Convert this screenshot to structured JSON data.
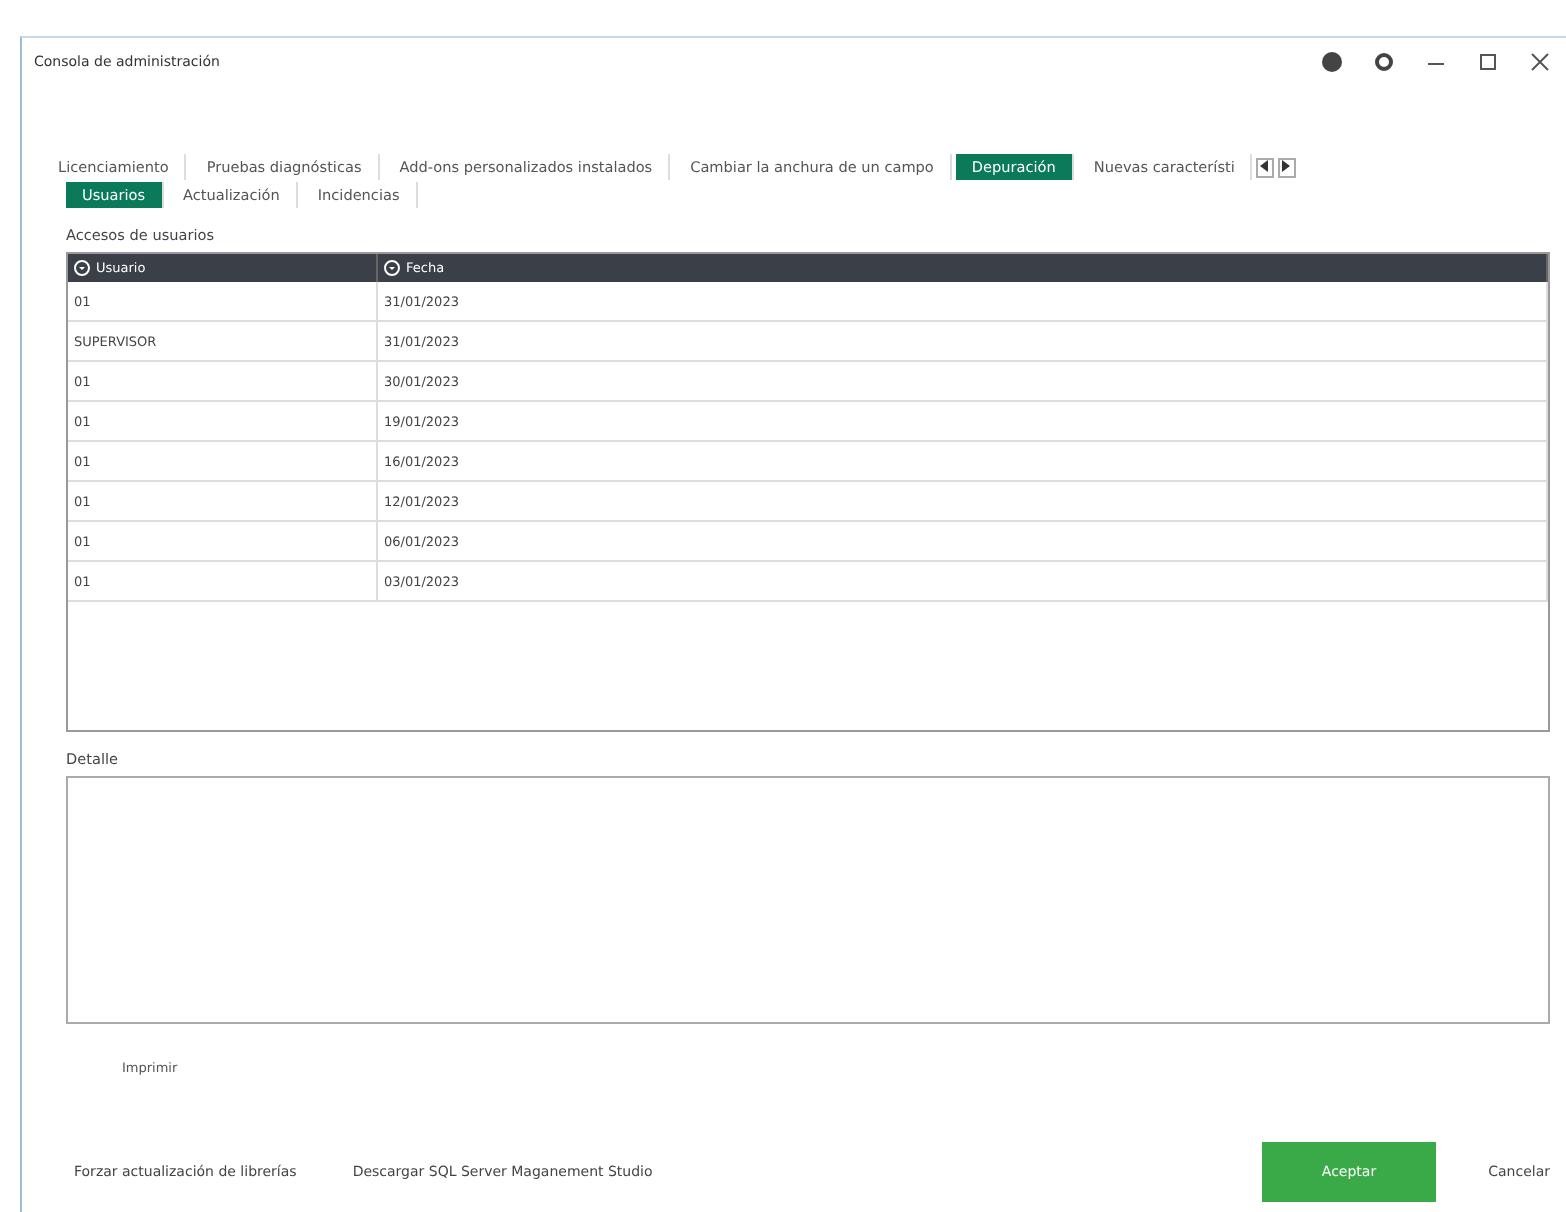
{
  "window": {
    "title": "Consola de administración"
  },
  "tabs": [
    {
      "label": "Licenciamiento",
      "selected": false
    },
    {
      "label": "Pruebas diagnósticas",
      "selected": false
    },
    {
      "label": "Add-ons personalizados instalados",
      "selected": false
    },
    {
      "label": "Cambiar la anchura de un campo",
      "selected": false
    },
    {
      "label": "Depuración",
      "selected": true
    },
    {
      "label": "Nuevas característi",
      "selected": false
    }
  ],
  "subtabs": [
    {
      "label": "Usuarios",
      "selected": true
    },
    {
      "label": "Actualización",
      "selected": false
    },
    {
      "label": "Incidencias",
      "selected": false
    }
  ],
  "group_title": "Accesos de usuarios",
  "table": {
    "columns": [
      "Usuario",
      "Fecha"
    ],
    "rows": [
      [
        "01",
        "31/01/2023"
      ],
      [
        "SUPERVISOR",
        "31/01/2023"
      ],
      [
        "01",
        "30/01/2023"
      ],
      [
        "01",
        "19/01/2023"
      ],
      [
        "01",
        "16/01/2023"
      ],
      [
        "01",
        "12/01/2023"
      ],
      [
        "01",
        "06/01/2023"
      ],
      [
        "01",
        "03/01/2023"
      ]
    ]
  },
  "detail_label": "Detalle",
  "print_button": "Imprimir",
  "footer_buttons": [
    {
      "label": "Forzar actualización de librerías",
      "kind": "plain"
    },
    {
      "label": "Descargar SQL Server Maganement Studio",
      "kind": "plain"
    },
    {
      "label": "Aceptar",
      "kind": "primary"
    },
    {
      "label": "Cancelar",
      "kind": "plain"
    }
  ]
}
